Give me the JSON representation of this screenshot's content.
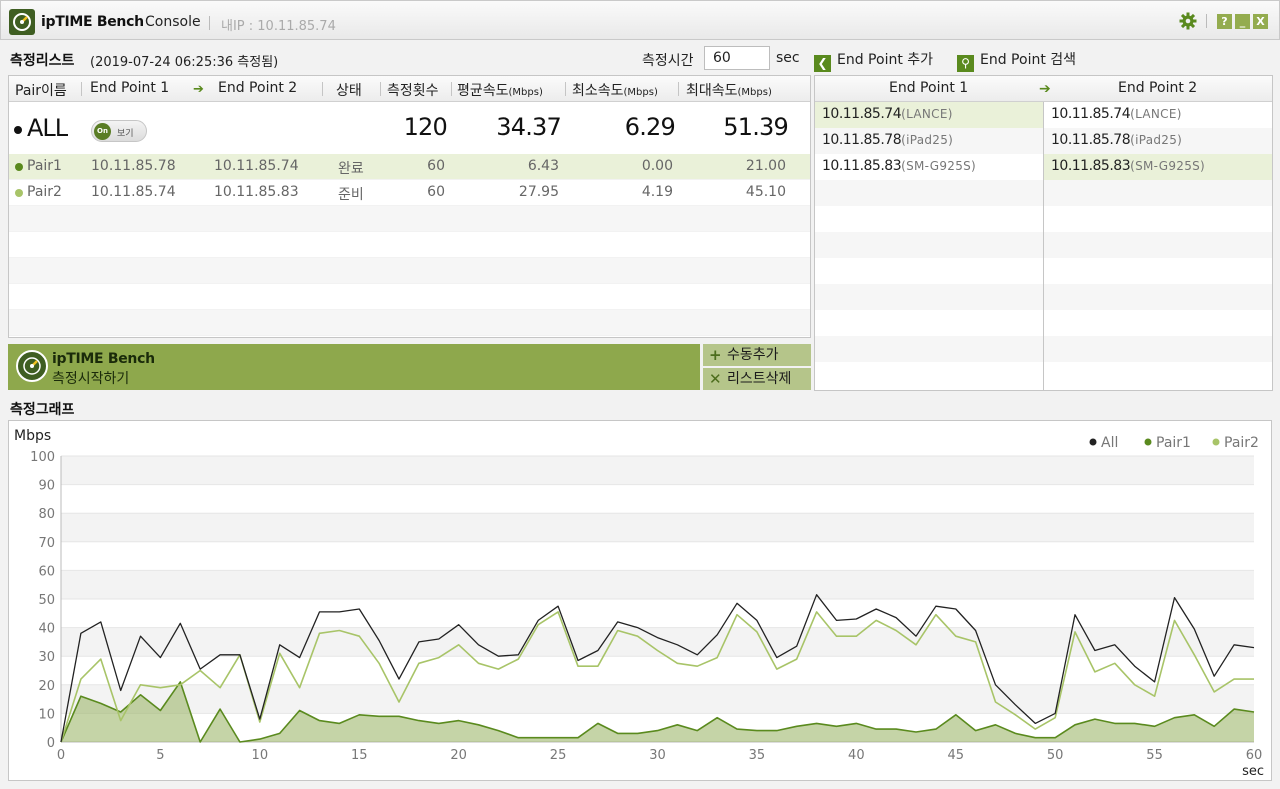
{
  "titlebar": {
    "brand": "ipTIME Bench",
    "console": "Console",
    "ip_label": "내IP : 10.11.85.74",
    "help_label": "?",
    "min_label": "_",
    "close_label": "X"
  },
  "list": {
    "title": "측정리스트",
    "date": "(2019-07-24 06:25:36 측정됨)",
    "measure_time_label": "측정시간",
    "measure_time_value": "60",
    "measure_time_unit": "sec",
    "add_endpoint_label": "End Point 추가",
    "search_endpoint_label": "End Point 검색",
    "columns": {
      "pair": "Pair이름",
      "ep1": "End Point 1",
      "ep2": "End Point 2",
      "status": "상태",
      "count": "측정횟수",
      "avg": "평균속도",
      "min": "최소속도",
      "max": "최대속도",
      "unit": "(Mbps)"
    },
    "all_row": {
      "label": "ALL",
      "toggle_on": "On",
      "toggle_text": "보기",
      "count": "120",
      "avg": "34.37",
      "min": "6.29",
      "max": "51.39"
    },
    "rows": [
      {
        "name": "Pair1",
        "ep1": "10.11.85.78",
        "ep2": "10.11.85.74",
        "status": "완료",
        "count": "60",
        "avg": "6.43",
        "min": "0.00",
        "max": "21.00",
        "color": "#5a8a1e"
      },
      {
        "name": "Pair2",
        "ep1": "10.11.85.74",
        "ep2": "10.11.85.83",
        "status": "준비",
        "count": "60",
        "avg": "27.95",
        "min": "4.19",
        "max": "45.10",
        "color": "#a8c468"
      }
    ]
  },
  "actions": {
    "start_title": "ipTIME Bench",
    "start_sub": "측정시작하기",
    "manual_add": "수동추가",
    "list_delete": "리스트삭제"
  },
  "endpoints": {
    "col1": "End Point 1",
    "col2": "End Point 2",
    "list1": [
      {
        "ip": "10.11.85.74",
        "name": "(LANCE)"
      },
      {
        "ip": "10.11.85.78",
        "name": "(iPad25)"
      },
      {
        "ip": "10.11.85.83",
        "name": "(SM-G925S)"
      }
    ],
    "list2": [
      {
        "ip": "10.11.85.74",
        "name": "(LANCE)"
      },
      {
        "ip": "10.11.85.78",
        "name": "(iPad25)"
      },
      {
        "ip": "10.11.85.83",
        "name": "(SM-G925S)"
      }
    ]
  },
  "graph": {
    "title": "측정그래프"
  },
  "chart_data": {
    "type": "line",
    "ylabel": "Mbps",
    "xlabel": "sec",
    "xlim": [
      0,
      60
    ],
    "ylim": [
      0,
      100
    ],
    "x_ticks": [
      0,
      5,
      10,
      15,
      20,
      25,
      30,
      35,
      40,
      45,
      50,
      55,
      60
    ],
    "y_ticks": [
      0,
      10,
      20,
      30,
      40,
      50,
      60,
      70,
      80,
      90,
      100
    ],
    "legend_position": "top-right",
    "grid": "horizontal-bands",
    "series": [
      {
        "name": "All",
        "color": "#222222",
        "fill": false,
        "values": [
          0,
          38,
          42,
          18,
          37,
          29.5,
          41.5,
          25.5,
          30.5,
          30.5,
          8,
          34,
          29.5,
          45.5,
          45.5,
          46.5,
          35.5,
          22,
          35,
          36,
          41,
          34,
          30,
          30.5,
          42.5,
          47.5,
          28.5,
          32,
          42,
          40,
          36.5,
          34,
          30.5,
          37.5,
          48.5,
          42.5,
          29.5,
          33.5,
          51.5,
          42.5,
          43,
          46.5,
          43.5,
          37,
          47.5,
          46.5,
          39,
          20,
          13,
          6.5,
          10,
          44.5,
          32,
          34,
          26.5,
          21,
          50.5,
          39.5,
          23,
          34,
          33
        ]
      },
      {
        "name": "Pair1",
        "color": "#5a8a1e",
        "fill": true,
        "values": [
          0,
          16,
          13.5,
          10.5,
          16.5,
          11,
          21,
          0,
          11.5,
          0,
          1,
          3,
          11,
          7.5,
          6.5,
          9.5,
          9,
          9,
          7.5,
          6.5,
          7.5,
          6,
          4,
          1.5,
          1.5,
          1.5,
          1.5,
          6.5,
          3,
          3,
          4,
          6,
          4,
          8.5,
          4.5,
          4,
          4,
          5.5,
          6.5,
          5.5,
          6.5,
          4.5,
          4.5,
          3.5,
          4.5,
          9.5,
          4,
          6,
          3,
          1.5,
          1.5,
          6,
          8,
          6.5,
          6.5,
          5.5,
          8.5,
          9.5,
          5.5,
          11.5,
          10.5
        ]
      },
      {
        "name": "Pair2",
        "color": "#a8c468",
        "fill": false,
        "values": [
          0,
          22,
          29,
          7.5,
          20,
          19,
          20,
          25,
          19,
          30.5,
          7,
          31,
          19,
          38,
          39,
          37,
          27.5,
          14,
          27.5,
          29.5,
          34,
          27.5,
          25.5,
          29,
          41,
          45.5,
          26.5,
          26.5,
          39,
          37,
          32,
          27.5,
          26.5,
          29.5,
          44.5,
          38.5,
          25.5,
          29,
          45.5,
          37,
          37,
          42.5,
          39,
          34,
          44.5,
          37,
          35,
          14,
          9.5,
          4.5,
          8.5,
          38.5,
          24.5,
          27.5,
          20,
          16,
          42.5,
          30.5,
          17.5,
          22,
          22
        ]
      }
    ]
  }
}
